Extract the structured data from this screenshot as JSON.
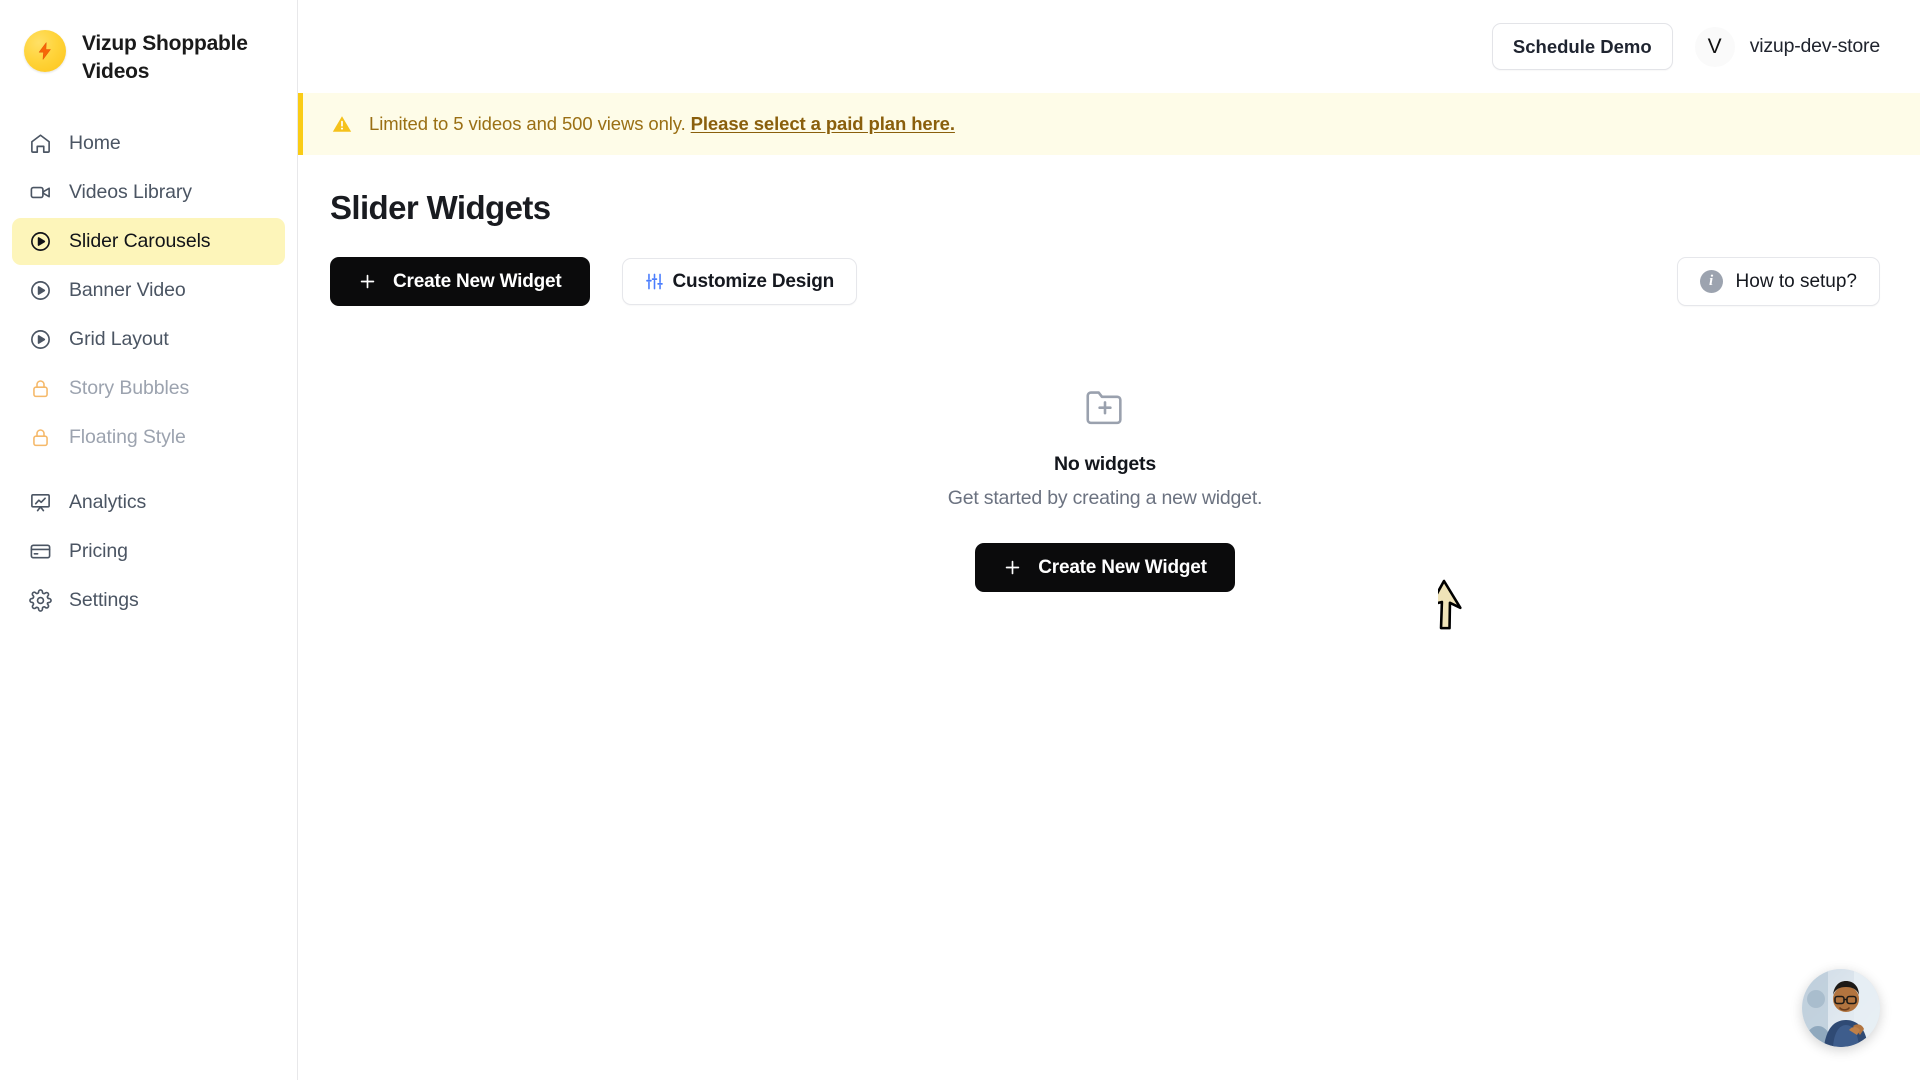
{
  "brand": {
    "name": "Vizup Shoppable Videos",
    "logo_icon": "lightning-bolt-icon"
  },
  "sidebar": {
    "items": [
      {
        "label": "Home",
        "icon": "home-icon",
        "state": "default"
      },
      {
        "label": "Videos Library",
        "icon": "video-camera-icon",
        "state": "default"
      },
      {
        "label": "Slider Carousels",
        "icon": "play-circle-icon",
        "state": "active"
      },
      {
        "label": "Banner Video",
        "icon": "play-circle-icon",
        "state": "default"
      },
      {
        "label": "Grid Layout",
        "icon": "play-circle-icon",
        "state": "default"
      },
      {
        "label": "Story Bubbles",
        "icon": "lock-icon",
        "state": "locked"
      },
      {
        "label": "Floating Style",
        "icon": "lock-icon",
        "state": "locked"
      },
      {
        "label": "Analytics",
        "icon": "analytics-board-icon",
        "state": "default"
      },
      {
        "label": "Pricing",
        "icon": "credit-card-icon",
        "state": "default"
      },
      {
        "label": "Settings",
        "icon": "gear-icon",
        "state": "default"
      }
    ]
  },
  "header": {
    "schedule_demo_label": "Schedule Demo",
    "avatar_initial": "V",
    "store_name": "vizup-dev-store"
  },
  "banner": {
    "icon": "warning-triangle-icon",
    "text": "Limited to 5 videos and 500 views only.",
    "link_text": "Please select a paid plan here."
  },
  "page": {
    "title": "Slider Widgets",
    "create_button_label": "Create New Widget",
    "create_button_icon": "plus-icon",
    "customize_button_label": "Customize Design",
    "customize_button_icon": "sliders-icon",
    "setup_button_label": "How to setup?",
    "setup_button_icon": "info-circle-icon"
  },
  "empty_state": {
    "icon": "folder-plus-icon",
    "title": "No widgets",
    "subtitle": "Get started by creating a new widget.",
    "button_label": "Create New Widget",
    "button_icon": "plus-icon"
  },
  "chat_widget": {
    "icon": "support-agent-avatar"
  },
  "colors": {
    "accent_yellow": "#facc15",
    "active_nav_bg": "#fdf5ba",
    "banner_bg": "#fefce8",
    "banner_text": "#9a6f14",
    "primary_button_bg": "#0b0b0c",
    "lock_icon": "#f5b96a",
    "customize_icon_blue": "#4a7dfd"
  }
}
